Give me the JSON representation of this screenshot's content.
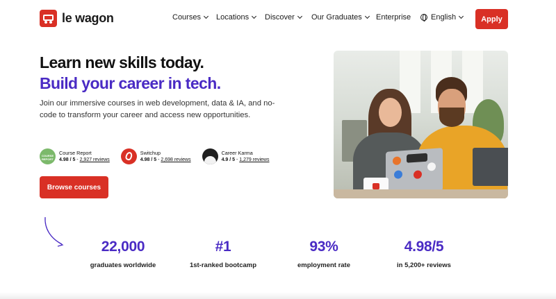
{
  "brand": {
    "name": "le wagon",
    "accent": "#d93025",
    "highlight": "#4a2bc4"
  },
  "nav": {
    "items": [
      {
        "label": "Courses",
        "dropdown": true
      },
      {
        "label": "Locations",
        "dropdown": true
      },
      {
        "label": "Discover",
        "dropdown": true
      },
      {
        "label": "Our Graduates",
        "dropdown": true
      },
      {
        "label": "Enterprise",
        "dropdown": false
      }
    ],
    "language": "English",
    "apply_label": "Apply"
  },
  "hero": {
    "title": "Learn new skills today.",
    "subtitle": "Build your career in tech.",
    "lead": "Join our immersive courses in web development, data & IA, and no-code to transform your career and access new opportunities.",
    "cta_label": "Browse courses"
  },
  "ratings": [
    {
      "name": "Course Report",
      "score": "4.98 / 5",
      "reviews": "2,927 reviews",
      "icon": "course-report-logo"
    },
    {
      "name": "Switchup",
      "score": "4.98 / 5",
      "reviews": "2,698 reviews",
      "icon": "switchup-logo"
    },
    {
      "name": "Career Karma",
      "score": "4.9 / 5",
      "reviews": "1,279 reviews",
      "icon": "career-karma-logo"
    }
  ],
  "stats": [
    {
      "value": "22,000",
      "label": "graduates worldwide"
    },
    {
      "value": "#1",
      "label": "1st-ranked bootcamp"
    },
    {
      "value": "93%",
      "label": "employment rate"
    },
    {
      "value": "4.98/5",
      "label": "in 5,200+ reviews"
    }
  ]
}
